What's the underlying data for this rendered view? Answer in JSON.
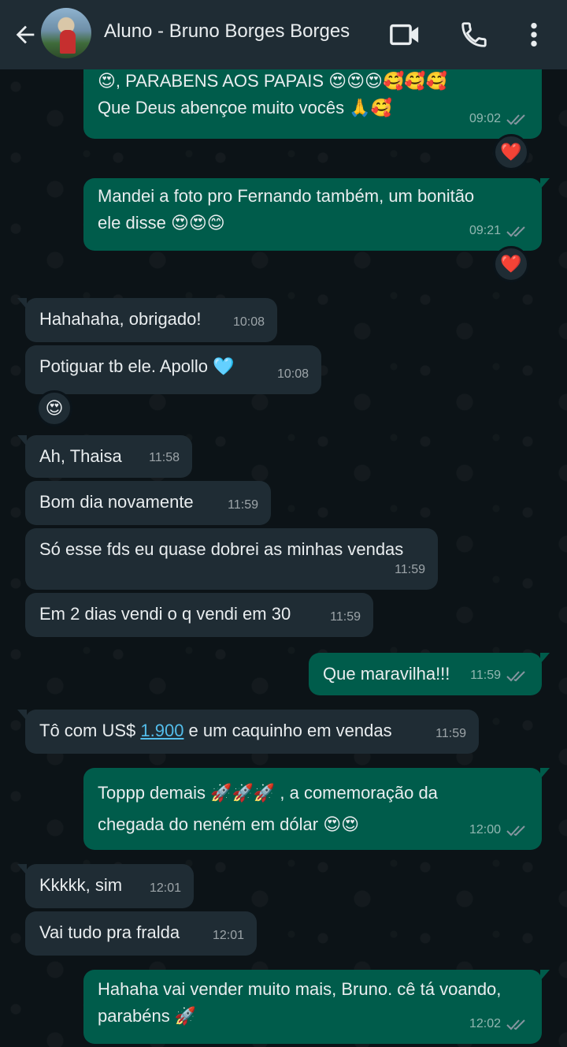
{
  "header": {
    "contact_name": "Aluno - Bruno Borges Borges"
  },
  "icons": {
    "back": "arrow-left-icon",
    "video": "video-camera-icon",
    "call": "phone-icon",
    "menu": "more-vertical-icon"
  },
  "colors": {
    "outgoing_bubble": "#005c4b",
    "incoming_bubble": "#1f2c34",
    "link": "#53bdeb",
    "ticks": "#8696a0",
    "heart": "#e8374a"
  },
  "messages": [
    {
      "dir": "out",
      "text": "😍, PARABENS AOS PAPAIS 😍😍😍🥰🥰🥰\nQue Deus abençoe muito vocês 🙏🥰",
      "time": "09:02",
      "reaction": "❤️"
    },
    {
      "dir": "out",
      "text": "Mandei a foto pro Fernando também, um bonitão\nele disse 😍😍😊",
      "time": "09:21",
      "reaction": "❤️"
    },
    {
      "dir": "in",
      "text": "Hahahaha, obrigado!",
      "time": "10:08"
    },
    {
      "dir": "in",
      "text": "Potiguar tb ele. Apollo 🩵",
      "time": "10:08",
      "reaction": "😍"
    },
    {
      "dir": "in",
      "text": "Ah, Thaisa",
      "time": "11:58"
    },
    {
      "dir": "in",
      "text": "Bom dia novamente",
      "time": "11:59"
    },
    {
      "dir": "in",
      "text": "Só esse fds eu quase dobrei as minhas vendas",
      "time": "11:59"
    },
    {
      "dir": "in",
      "text": "Em 2 dias vendi o q vendi em 30",
      "time": "11:59"
    },
    {
      "dir": "out",
      "text": "Que maravilha!!!",
      "time": "11:59"
    },
    {
      "dir": "in",
      "text_before": "Tô com US$ ",
      "link": "1.900",
      "text_after": " e um caquinho em vendas",
      "time": "11:59"
    },
    {
      "dir": "out",
      "text": "Toppp demais 🚀🚀🚀 , a comemoração da\nchegada do neném em dólar 😍😍",
      "time": "12:00"
    },
    {
      "dir": "in",
      "text": "Kkkkk, sim",
      "time": "12:01"
    },
    {
      "dir": "in",
      "text": "Vai tudo pra fralda",
      "time": "12:01"
    },
    {
      "dir": "out",
      "text": "Hahaha vai vender muito mais, Bruno. cê tá voando,\nparabéns 🚀",
      "time": "12:02"
    }
  ]
}
